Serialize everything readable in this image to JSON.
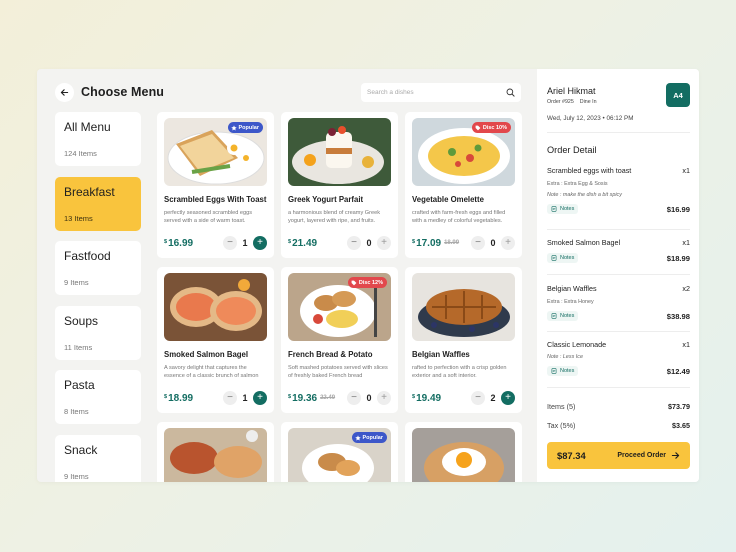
{
  "header": {
    "title": "Choose Menu",
    "search_placeholder": "Search a dishes"
  },
  "categories": [
    {
      "name": "All Menu",
      "count": "124 Items",
      "active": false
    },
    {
      "name": "Breakfast",
      "count": "13 Items",
      "active": true
    },
    {
      "name": "Fastfood",
      "count": "9 Items",
      "active": false
    },
    {
      "name": "Soups",
      "count": "11 Items",
      "active": false
    },
    {
      "name": "Pasta",
      "count": "8 Items",
      "active": false
    },
    {
      "name": "Snack",
      "count": "9 Items",
      "active": false
    }
  ],
  "menu": [
    {
      "name": "Scrambled Eggs With Toast",
      "desc": "perfectly seasoned scrambled eggs served with a side of warm toast.",
      "currency": "$",
      "price": "16.99",
      "old_price": "",
      "qty": "1",
      "badge": "Popular",
      "badge_color": "#3d57c9"
    },
    {
      "name": "Greek Yogurt Parfait",
      "desc": "a harmonious blend of creamy Greek yogurt, layered with ripe, and fruits.",
      "currency": "$",
      "price": "21.49",
      "old_price": "",
      "qty": "0",
      "badge": "",
      "badge_color": ""
    },
    {
      "name": "Vegetable Omelette",
      "desc": "crafted with farm-fresh eggs and filled with a medley of colorful vegetables.",
      "currency": "$",
      "price": "17.09",
      "old_price": "18.99",
      "qty": "0",
      "badge": "Disc 10%",
      "badge_color": "#e2484c"
    },
    {
      "name": "Smoked Salmon Bagel",
      "desc": "A savory delight that captures the essence of a classic brunch of salmon",
      "currency": "$",
      "price": "18.99",
      "old_price": "",
      "qty": "1",
      "badge": "",
      "badge_color": ""
    },
    {
      "name": "French Bread & Potato",
      "desc": "Soft mashed potatoes served with slices of freshly baked French bread",
      "currency": "$",
      "price": "19.36",
      "old_price": "22.49",
      "qty": "0",
      "badge": "Disc 12%",
      "badge_color": "#e2484c"
    },
    {
      "name": "Belgian Waffles",
      "desc": "rafted to perfection with a crisp golden exterior and a soft interior.",
      "currency": "$",
      "price": "19.49",
      "old_price": "",
      "qty": "2",
      "badge": "",
      "badge_color": ""
    },
    {
      "name": "",
      "desc": "",
      "currency": "",
      "price": "",
      "old_price": "",
      "qty": "",
      "badge": "",
      "badge_color": ""
    },
    {
      "name": "",
      "desc": "",
      "currency": "",
      "price": "",
      "old_price": "",
      "qty": "",
      "badge": "Popular",
      "badge_color": "#3d57c9"
    },
    {
      "name": "",
      "desc": "",
      "currency": "",
      "price": "",
      "old_price": "",
      "qty": "",
      "badge": "",
      "badge_color": ""
    }
  ],
  "order": {
    "customer": "Ariel Hikmat",
    "order_no": "Order #925",
    "type": "Dine In",
    "avatar": "A4",
    "datetime": "Wed, July 12, 2023 • 06:12 PM",
    "title": "Order Detail",
    "notes_label": "Notes",
    "items": [
      {
        "name": "Scrambled eggs with toast",
        "qty": "x1",
        "extra": "Extra : Extra Egg & Sosis",
        "note": "Note : make the dish a bit spicy",
        "price": "$16.99"
      },
      {
        "name": "Smoked Salmon Bagel",
        "qty": "x1",
        "extra": "",
        "note": "",
        "price": "$18.99"
      },
      {
        "name": "Belgian Waffles",
        "qty": "x2",
        "extra": "Extra : Extra Honey",
        "note": "",
        "price": "$38.98"
      },
      {
        "name": "Classic Lemonade",
        "qty": "x1",
        "extra": "",
        "note": "Note : Less Ice",
        "price": "$12.49"
      }
    ],
    "items_label": "Items (5)",
    "items_total": "$73.79",
    "tax_label": "Tax (5%)",
    "tax_total": "$3.65",
    "grand_total": "$87.34",
    "proceed_label": "Proceed Order"
  },
  "colors": {
    "accent_yellow": "#f9c43d",
    "accent_green": "#136d62",
    "badge_blue": "#3d57c9",
    "badge_red": "#e2484c"
  },
  "icons": [
    "arrow-left-icon",
    "search-icon",
    "star-icon",
    "tag-icon",
    "minus-icon",
    "plus-icon",
    "notes-icon",
    "arrow-right-icon"
  ]
}
